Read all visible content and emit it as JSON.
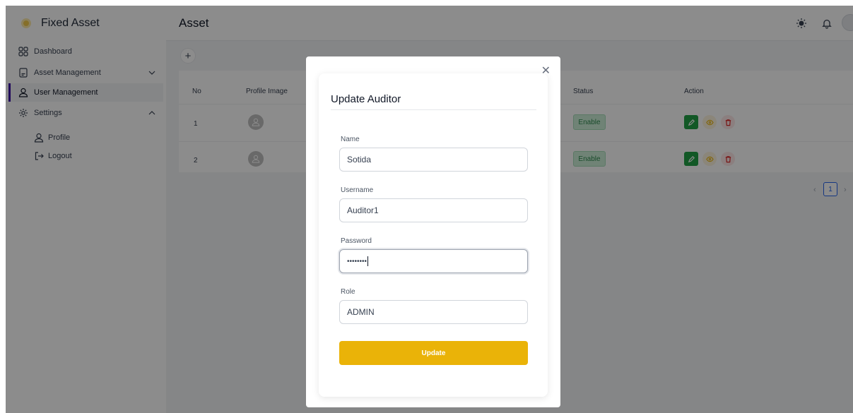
{
  "app": {
    "brand": "Fixed Asset",
    "page_title": "Asset"
  },
  "sidebar": {
    "items": [
      {
        "label": "Dashboard"
      },
      {
        "label": "Asset Management"
      },
      {
        "label": "User Management"
      },
      {
        "label": "Settings"
      },
      {
        "label": "Profile"
      },
      {
        "label": "Logout"
      }
    ]
  },
  "table": {
    "headers": {
      "no": "No",
      "profile_image": "Profile Image",
      "status": "Status",
      "action": "Action"
    },
    "rows": [
      {
        "no": "1",
        "status": "Enable"
      },
      {
        "no": "2",
        "status": "Enable"
      }
    ]
  },
  "pagination": {
    "current_page": "1"
  },
  "modal": {
    "title": "Update Auditor",
    "name_label": "Name",
    "name_value": "Sotida",
    "username_label": "Username",
    "username_value": "Auditor1",
    "password_label": "Password",
    "password_masked": "••••••••",
    "role_label": "Role",
    "role_value": "ADMIN",
    "submit_label": "Update"
  },
  "colors": {
    "accent": "#eab308",
    "edit_green": "#22a046",
    "status_badge": "#cdeed8",
    "active_indicator": "#3b0ea5"
  }
}
